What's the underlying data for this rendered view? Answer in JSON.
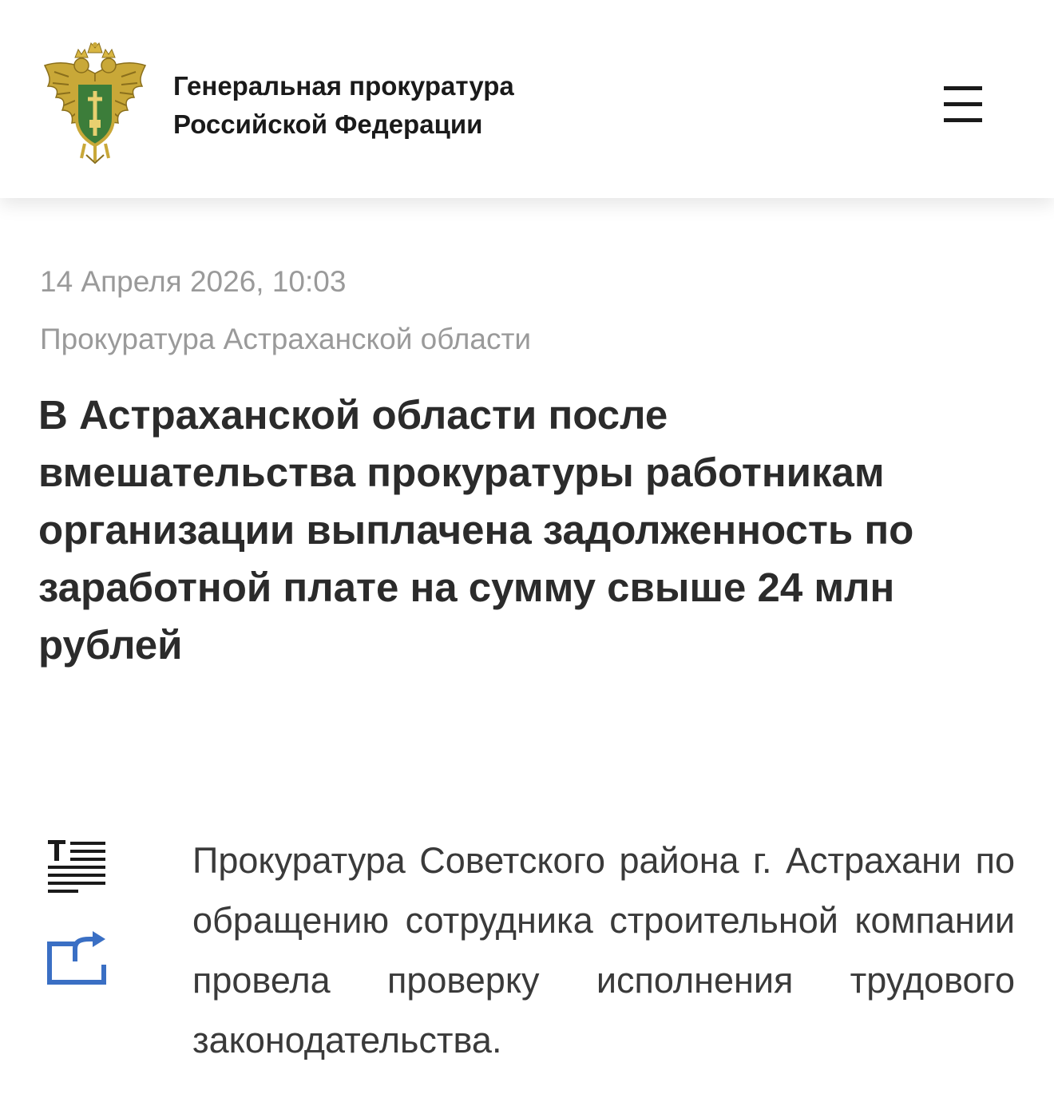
{
  "header": {
    "org_name_line1": "Генеральная прокуратура",
    "org_name_line2": "Российской Федерации",
    "emblem_icon": "prosecutor-emblem-icon",
    "menu_icon": "hamburger-menu-icon"
  },
  "article": {
    "date": "14 Апреля 2026, 10:03",
    "source": "Прокуратура Астраханской области",
    "headline_lines": [
      "В Астраханской области после",
      "вмешательства прокуратуры работникам",
      "организации выплачена задолженность по",
      "заработной плате на сумму свыше 24 млн",
      "рублей"
    ],
    "body": "Прокуратура Советского района г. Астрахани по обращению сотрудника строительной компании провела проверку исполнения трудового законодательства."
  },
  "tools": {
    "text_size_icon": "text-size-icon",
    "share_icon": "share-icon",
    "accent_color": "#3a6fc4"
  },
  "colors": {
    "meta_text": "#9a9a9a",
    "headline_text": "#2b2b2b",
    "body_text": "#3a3a3a",
    "emblem_gold": "#c9a838",
    "emblem_green": "#3c7d3a"
  }
}
